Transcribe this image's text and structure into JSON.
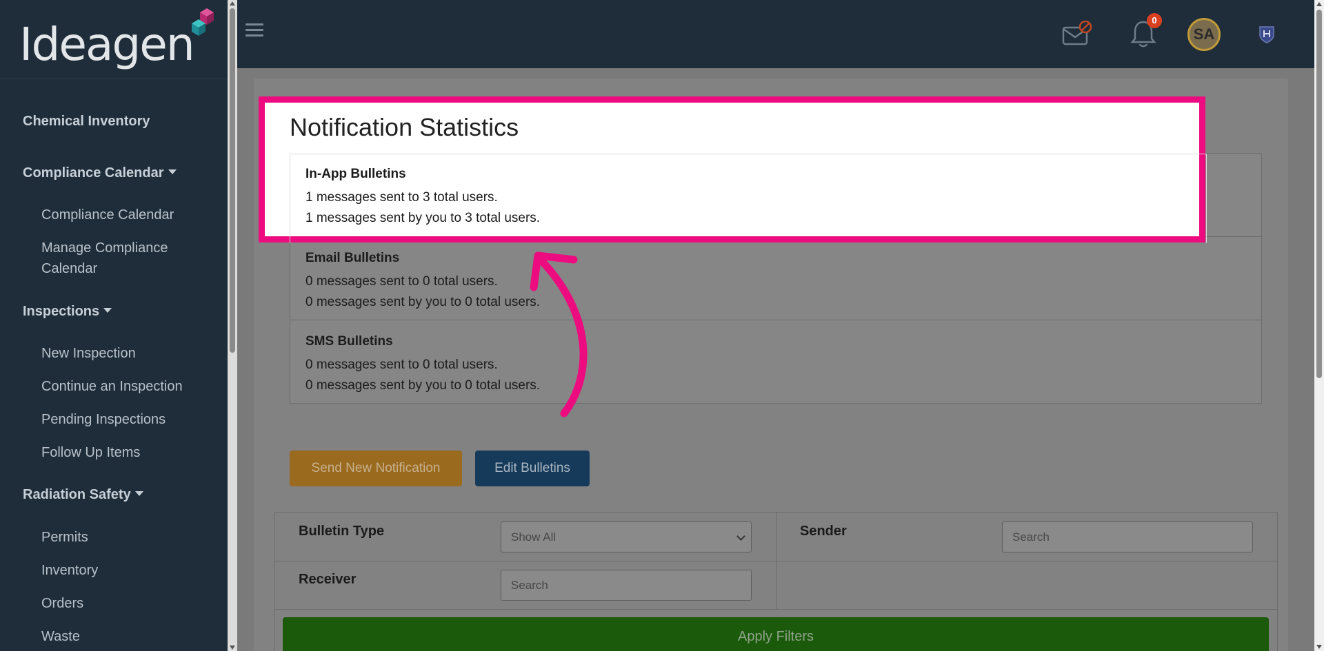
{
  "app": {
    "logo_text": "Ideagen"
  },
  "sidebar": {
    "sections": [
      {
        "label": "Chemical Inventory"
      },
      {
        "label": "Compliance Calendar",
        "items": [
          "Compliance Calendar",
          "Manage Compliance Calendar"
        ]
      },
      {
        "label": "Inspections",
        "items": [
          "New Inspection",
          "Continue an Inspection",
          "Pending Inspections",
          "Follow Up Items"
        ]
      },
      {
        "label": "Radiation Safety",
        "items": [
          "Permits",
          "Inventory",
          "Orders",
          "Waste"
        ]
      }
    ]
  },
  "topbar": {
    "notification_count": "0",
    "avatar_initials": "SA",
    "icons": [
      "menu-icon",
      "mail-blocked-icon",
      "bell-icon",
      "avatar",
      "profile-logo-icon"
    ]
  },
  "stats": {
    "title": "Notification Statistics",
    "rows": [
      {
        "title": "In-App Bulletins",
        "line1": "1 messages sent to 3 total users.",
        "line2": "1 messages sent by you to 3 total users."
      },
      {
        "title": "Email Bulletins",
        "line1": "0 messages sent to 0 total users.",
        "line2": "0 messages sent by you to 0 total users."
      },
      {
        "title": "SMS Bulletins",
        "line1": "0 messages sent to 0 total users.",
        "line2": "0 messages sent by you to 0 total users."
      }
    ]
  },
  "actions": {
    "send_label": "Send New Notification",
    "edit_label": "Edit Bulletins"
  },
  "filters": {
    "bulletin_type_label": "Bulletin Type",
    "bulletin_type_value": "Show All",
    "sender_label": "Sender",
    "sender_placeholder": "Search",
    "receiver_label": "Receiver",
    "receiver_placeholder": "Search",
    "apply_label": "Apply Filters"
  },
  "colors": {
    "highlight": "#ec0c7f",
    "orange_button": "#e8971f",
    "blue_button": "#1f6fb2",
    "apply_button": "#2f8c12"
  }
}
